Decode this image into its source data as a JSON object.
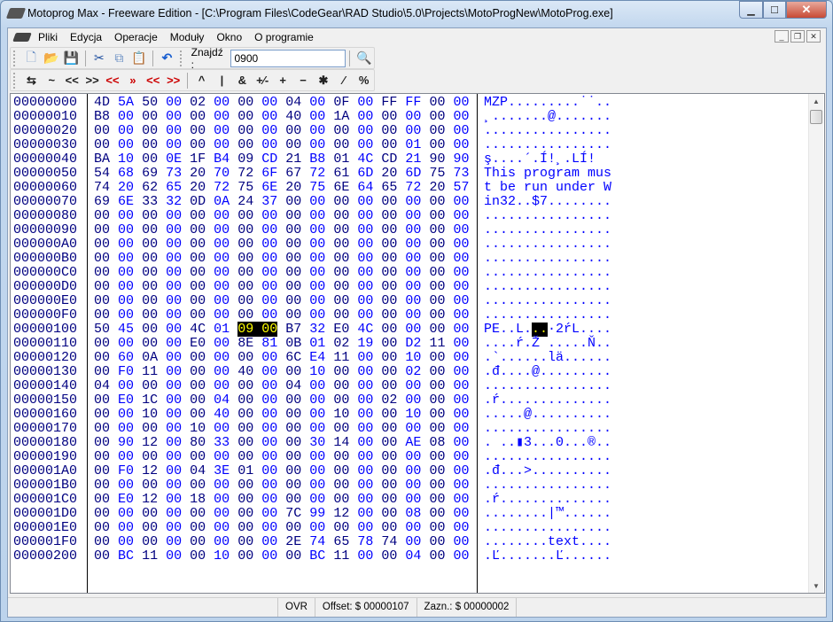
{
  "window": {
    "title": "Motoprog Max - Freeware Edition - [C:\\Program Files\\CodeGear\\RAD Studio\\5.0\\Projects\\MotoProgNew\\MotoProg.exe]"
  },
  "menu": [
    "Pliki",
    "Edycja",
    "Operacje",
    "Moduły",
    "Okno",
    "O programie"
  ],
  "toolbar": {
    "find_label": "Znajdź :",
    "find_value": "0900",
    "ops": [
      "⇆",
      "~",
      "<<",
      ">>",
      "<<",
      "»",
      "<<",
      ">>",
      "^",
      "|",
      "&",
      "+∕-",
      "+",
      "−",
      "✱",
      "∕",
      "%"
    ]
  },
  "editor": {
    "selection": {
      "row": 16,
      "cols": [
        6,
        7
      ]
    },
    "rows": [
      {
        "offset": "00000000",
        "hex": "4D 5A 50 00 02 00 00 00 04 00 0F 00 FF FF 00 00",
        "ascii": "MZP.........˙˙.."
      },
      {
        "offset": "00000010",
        "hex": "B8 00 00 00 00 00 00 00 40 00 1A 00 00 00 00 00",
        "ascii": "¸.......@......."
      },
      {
        "offset": "00000020",
        "hex": "00 00 00 00 00 00 00 00 00 00 00 00 00 00 00 00",
        "ascii": "................"
      },
      {
        "offset": "00000030",
        "hex": "00 00 00 00 00 00 00 00 00 00 00 00 00 01 00 00",
        "ascii": "................"
      },
      {
        "offset": "00000040",
        "hex": "BA 10 00 0E 1F B4 09 CD 21 B8 01 4C CD 21 90 90",
        "ascii": "ş....´.Í!¸.LÍ!  "
      },
      {
        "offset": "00000050",
        "hex": "54 68 69 73 20 70 72 6F 67 72 61 6D 20 6D 75 73",
        "ascii": "This program mus"
      },
      {
        "offset": "00000060",
        "hex": "74 20 62 65 20 72 75 6E 20 75 6E 64 65 72 20 57",
        "ascii": "t be run under W"
      },
      {
        "offset": "00000070",
        "hex": "69 6E 33 32 0D 0A 24 37 00 00 00 00 00 00 00 00",
        "ascii": "in32..$7........"
      },
      {
        "offset": "00000080",
        "hex": "00 00 00 00 00 00 00 00 00 00 00 00 00 00 00 00",
        "ascii": "................"
      },
      {
        "offset": "00000090",
        "hex": "00 00 00 00 00 00 00 00 00 00 00 00 00 00 00 00",
        "ascii": "................"
      },
      {
        "offset": "000000A0",
        "hex": "00 00 00 00 00 00 00 00 00 00 00 00 00 00 00 00",
        "ascii": "................"
      },
      {
        "offset": "000000B0",
        "hex": "00 00 00 00 00 00 00 00 00 00 00 00 00 00 00 00",
        "ascii": "................"
      },
      {
        "offset": "000000C0",
        "hex": "00 00 00 00 00 00 00 00 00 00 00 00 00 00 00 00",
        "ascii": "................"
      },
      {
        "offset": "000000D0",
        "hex": "00 00 00 00 00 00 00 00 00 00 00 00 00 00 00 00",
        "ascii": "................"
      },
      {
        "offset": "000000E0",
        "hex": "00 00 00 00 00 00 00 00 00 00 00 00 00 00 00 00",
        "ascii": "................"
      },
      {
        "offset": "000000F0",
        "hex": "00 00 00 00 00 00 00 00 00 00 00 00 00 00 00 00",
        "ascii": "................"
      },
      {
        "offset": "00000100",
        "hex": "50 45 00 00 4C 01 09 00 B7 32 E0 4C 00 00 00 00",
        "ascii": "PE..L...·2ŕL...."
      },
      {
        "offset": "00000110",
        "hex": "00 00 00 00 E0 00 8E 81 0B 01 02 19 00 D2 11 00",
        "ascii": "....ŕ.Ž .....Ň.."
      },
      {
        "offset": "00000120",
        "hex": "00 60 0A 00 00 00 00 00 6C E4 11 00 00 10 00 00",
        "ascii": ".`......lä......"
      },
      {
        "offset": "00000130",
        "hex": "00 F0 11 00 00 00 40 00 00 10 00 00 00 02 00 00",
        "ascii": ".đ....@........."
      },
      {
        "offset": "00000140",
        "hex": "04 00 00 00 00 00 00 00 04 00 00 00 00 00 00 00",
        "ascii": "................"
      },
      {
        "offset": "00000150",
        "hex": "00 E0 1C 00 00 04 00 00 00 00 00 00 02 00 00 00",
        "ascii": ".ŕ.............."
      },
      {
        "offset": "00000160",
        "hex": "00 00 10 00 00 40 00 00 00 00 10 00 00 10 00 00",
        "ascii": ".....@.........."
      },
      {
        "offset": "00000170",
        "hex": "00 00 00 00 10 00 00 00 00 00 00 00 00 00 00 00",
        "ascii": "................"
      },
      {
        "offset": "00000180",
        "hex": "00 90 12 00 80 33 00 00 00 30 14 00 00 AE 08 00",
        "ascii": ". ..▮3...0...®.."
      },
      {
        "offset": "00000190",
        "hex": "00 00 00 00 00 00 00 00 00 00 00 00 00 00 00 00",
        "ascii": "................"
      },
      {
        "offset": "000001A0",
        "hex": "00 F0 12 00 04 3E 01 00 00 00 00 00 00 00 00 00",
        "ascii": ".đ...>.........."
      },
      {
        "offset": "000001B0",
        "hex": "00 00 00 00 00 00 00 00 00 00 00 00 00 00 00 00",
        "ascii": "................"
      },
      {
        "offset": "000001C0",
        "hex": "00 E0 12 00 18 00 00 00 00 00 00 00 00 00 00 00",
        "ascii": ".ŕ.............."
      },
      {
        "offset": "000001D0",
        "hex": "00 00 00 00 00 00 00 00 7C 99 12 00 00 08 00 00",
        "ascii": "........|™......"
      },
      {
        "offset": "000001E0",
        "hex": "00 00 00 00 00 00 00 00 00 00 00 00 00 00 00 00",
        "ascii": "................"
      },
      {
        "offset": "000001F0",
        "hex": "00 00 00 00 00 00 00 00 2E 74 65 78 74 00 00 00",
        "ascii": "........text...."
      },
      {
        "offset": "00000200",
        "hex": "00 BC 11 00 00 10 00 00 00 BC 11 00 00 04 00 00",
        "ascii": ".Ľ.......Ľ......"
      }
    ]
  },
  "status": {
    "mode": "OVR",
    "offset": "Offset: $ 00000107",
    "selection": "Zazn.: $ 00000002"
  }
}
